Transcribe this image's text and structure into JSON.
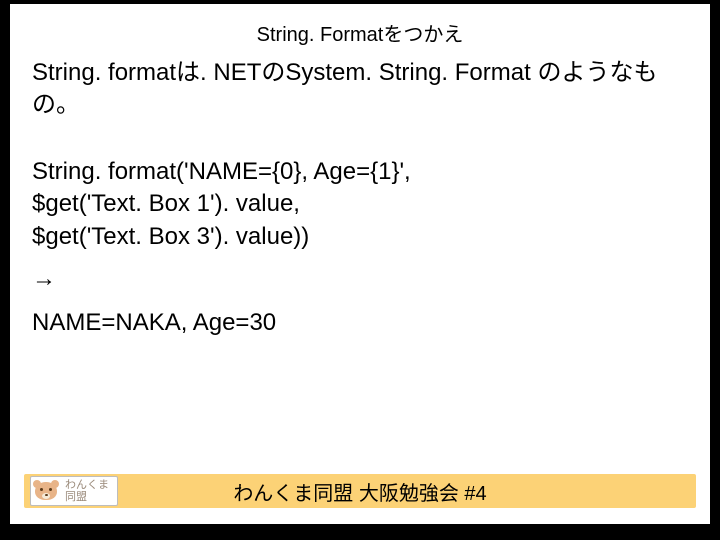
{
  "title": "String. Formatをつかえ",
  "body": {
    "para1": "String. formatは. NETのSystem. String. Format のようなもの。",
    "code_line1": "String. format('NAME={0}, Age={1}',",
    "code_line2": "$get('Text. Box 1'). value,",
    "code_line3": "$get('Text. Box 3'). value))",
    "arrow": "→",
    "result": "NAME=NAKA, Age=30"
  },
  "footer": {
    "logo_line1": "わんくま",
    "logo_line2": "同盟",
    "text": "わんくま同盟 大阪勉強会 #4"
  }
}
